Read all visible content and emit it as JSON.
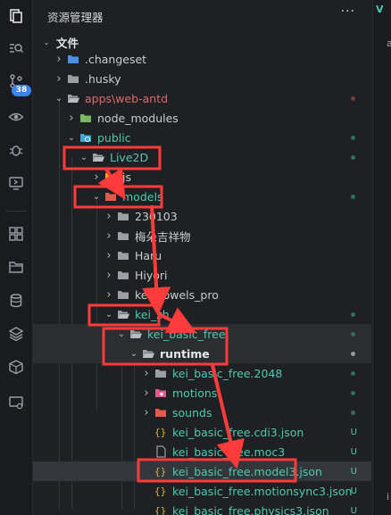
{
  "explorer": {
    "title": "资源管理器",
    "more": "···",
    "root": "文件"
  },
  "activity": {
    "badge": "38"
  },
  "editor": {
    "tab_letter": "V",
    "char_top": "a",
    "char_bottom": "i"
  },
  "colors": {
    "accent": "#3b82f6",
    "annotation_red": "#ff3b3b",
    "untracked_green": "#4ec9b0",
    "folder_yellow": "#e6b422",
    "folder_grey": "#9aa0a6"
  },
  "tree": [
    {
      "label": ".changeset",
      "depth": 1,
      "chev": "›",
      "icon": "folder-blue",
      "color": "#cccccc"
    },
    {
      "label": ".husky",
      "depth": 1,
      "chev": "›",
      "icon": "folder-grey",
      "color": "#cccccc"
    },
    {
      "label": "apps\\web-antd",
      "depth": 1,
      "chev": "⌄",
      "icon": "folder-open-grey",
      "color": "#d86a6a",
      "dot": "#7a3a3a"
    },
    {
      "label": "node_modules",
      "depth": 2,
      "chev": "›",
      "icon": "folder-green",
      "color": "#cccccc"
    },
    {
      "label": "public",
      "depth": 2,
      "chev": "⌄",
      "icon": "folder-globe",
      "color": "#4ec9b0",
      "dot": "#2f6e5f"
    },
    {
      "label": "Live2D",
      "depth": 3,
      "chev": "⌄",
      "icon": "folder-open-grey",
      "color": "#4ec9b0",
      "dot": "#2f6e5f"
    },
    {
      "label": "js",
      "depth": 4,
      "chev": "›",
      "icon": "folder-yellow",
      "color": "#cccccc"
    },
    {
      "label": "models",
      "depth": 4,
      "chev": "⌄",
      "icon": "folder-red",
      "color": "#4ec9b0",
      "dot": "#2f6e5f"
    },
    {
      "label": "230103",
      "depth": 5,
      "chev": "›",
      "icon": "folder-grey",
      "color": "#cccccc"
    },
    {
      "label": "梅朵吉祥物",
      "depth": 5,
      "chev": "›",
      "icon": "folder-grey",
      "color": "#cccccc"
    },
    {
      "label": "Haru",
      "depth": 5,
      "chev": "›",
      "icon": "folder-grey",
      "color": "#cccccc"
    },
    {
      "label": "Hiyori",
      "depth": 5,
      "chev": "›",
      "icon": "folder-grey",
      "color": "#cccccc"
    },
    {
      "label": "kei_vowels_pro",
      "depth": 5,
      "chev": "›",
      "icon": "folder-grey",
      "color": "#cccccc"
    },
    {
      "label": "kei_zh",
      "depth": 5,
      "chev": "⌄",
      "icon": "folder-open-grey",
      "color": "#4ec9b0",
      "dot": "#2f6e5f"
    },
    {
      "label": "kei_basic_free",
      "depth": 6,
      "chev": "⌄",
      "icon": "folder-open-grey",
      "color": "#4ec9b0",
      "dot": "#2f6e5f",
      "hover": true
    },
    {
      "label": "runtime",
      "depth": 7,
      "chev": "⌄",
      "icon": "folder-open-grey",
      "color": "#e8e8e8",
      "bold": true,
      "dot": "#9a9a9a",
      "hover": true
    },
    {
      "label": "kei_basic_free.2048",
      "depth": 8,
      "chev": "›",
      "icon": "folder-grey",
      "color": "#4ec9b0",
      "dot": "#2f6e5f"
    },
    {
      "label": "motions",
      "depth": 8,
      "chev": "›",
      "icon": "folder-pink",
      "color": "#4ec9b0",
      "dot": "#2f6e5f"
    },
    {
      "label": "sounds",
      "depth": 8,
      "chev": "›",
      "icon": "folder-red",
      "color": "#4ec9b0",
      "dot": "#2f6e5f"
    },
    {
      "label": "kei_basic_free.cdi3.json",
      "depth": 8,
      "icon": "json",
      "color": "#4ec9b0",
      "status": "U"
    },
    {
      "label": "kei_basic_free.moc3",
      "depth": 8,
      "icon": "file",
      "color": "#4ec9b0",
      "status": "U"
    },
    {
      "label": "kei_basic_free.model3.json",
      "depth": 8,
      "icon": "json",
      "color": "#4ec9b0",
      "status": "U",
      "selected": true
    },
    {
      "label": "kei_basic_free.motionsync3.json",
      "depth": 8,
      "icon": "json",
      "color": "#4ec9b0",
      "status": "U"
    },
    {
      "label": "kei_basic_free.physics3.json",
      "depth": 8,
      "icon": "json",
      "color": "#4ec9b0",
      "status": "U"
    }
  ]
}
